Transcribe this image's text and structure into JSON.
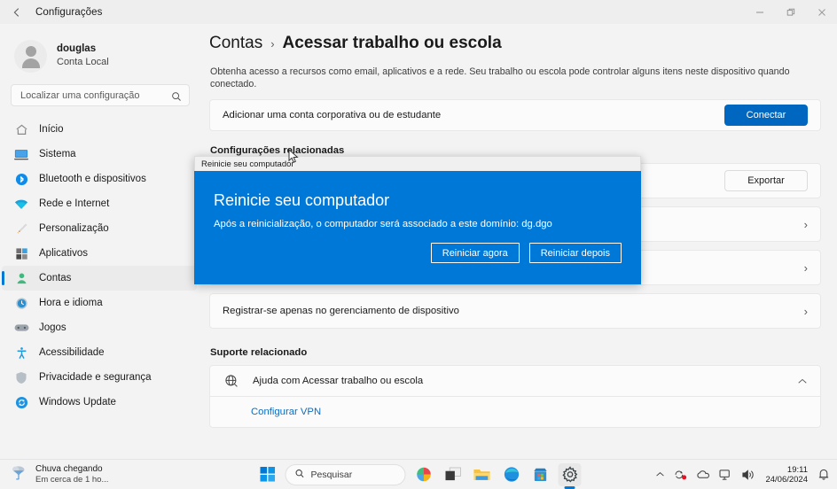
{
  "window": {
    "title": "Configurações",
    "back_icon": "back-arrow-icon",
    "minimize_label": "—",
    "maximize_label": "❐",
    "close_label": "✕"
  },
  "sidebar": {
    "profile": {
      "name": "douglas",
      "subtitle": "Conta Local"
    },
    "search": {
      "placeholder": "Localizar uma configuração",
      "icon": "search-icon"
    },
    "items": [
      {
        "label": "Início",
        "icon": "home-icon",
        "active": false
      },
      {
        "label": "Sistema",
        "icon": "system-icon",
        "active": false
      },
      {
        "label": "Bluetooth e dispositivos",
        "icon": "bluetooth-icon",
        "active": false
      },
      {
        "label": "Rede e Internet",
        "icon": "network-icon",
        "active": false
      },
      {
        "label": "Personalização",
        "icon": "personalization-icon",
        "active": false
      },
      {
        "label": "Aplicativos",
        "icon": "apps-icon",
        "active": false
      },
      {
        "label": "Contas",
        "icon": "accounts-icon",
        "active": true
      },
      {
        "label": "Hora e idioma",
        "icon": "time-icon",
        "active": false
      },
      {
        "label": "Jogos",
        "icon": "gaming-icon",
        "active": false
      },
      {
        "label": "Acessibilidade",
        "icon": "accessibility-icon",
        "active": false
      },
      {
        "label": "Privacidade e segurança",
        "icon": "privacy-icon",
        "active": false
      },
      {
        "label": "Windows Update",
        "icon": "update-icon",
        "active": false
      }
    ]
  },
  "main": {
    "breadcrumb_parent": "Contas",
    "breadcrumb_separator": "›",
    "breadcrumb_current": "Acessar trabalho ou escola",
    "description": "Obtenha acesso a recursos como email, aplicativos e a rede. Seu trabalho ou escola pode controlar alguns itens neste dispositivo quando conectado.",
    "add_account": {
      "label": "Adicionar uma conta corporativa ou de estudante",
      "button": "Conectar"
    },
    "related_settings_title": "Configurações relacionadas",
    "rows": [
      {
        "label": "",
        "action_type": "button",
        "action": "Exportar"
      },
      {
        "label": "",
        "action_type": "chevron",
        "action": "›"
      },
      {
        "label": "",
        "action_type": "chevron",
        "action": "›"
      },
      {
        "label": "Registrar-se apenas no gerenciamento de dispositivo",
        "action_type": "chevron",
        "action": "›"
      }
    ],
    "support_title": "Suporte relacionado",
    "support": {
      "label": "Ajuda com Acessar trabalho ou escola",
      "icon": "globe-help-icon",
      "expand_icon": "chevron-up-icon",
      "link": "Configurar VPN"
    }
  },
  "dialog": {
    "titlebar": "Reinicie seu computador",
    "heading": "Reinicie seu computador",
    "message": "Após a reinicialização, o computador será associado a este domínio: dg.dgo",
    "primary_button": "Reiniciar agora",
    "secondary_button": "Reiniciar depois",
    "background_color": "#0078d7"
  },
  "taskbar": {
    "weather": {
      "title": "Chuva chegando",
      "subtitle": "Em cerca de 1 ho...",
      "icon": "rain-icon"
    },
    "start": "start-icon",
    "search": {
      "placeholder": "Pesquisar",
      "icon": "search-icon"
    },
    "pinned": [
      {
        "name": "office-icon",
        "active": false
      },
      {
        "name": "task-view-icon",
        "active": false
      },
      {
        "name": "file-explorer-icon",
        "active": false
      },
      {
        "name": "edge-icon",
        "active": false
      },
      {
        "name": "microsoft-store-icon",
        "active": false
      },
      {
        "name": "settings-icon",
        "active": true
      }
    ],
    "tray": {
      "overflow": "^",
      "icons": [
        "onedrive-sync-icon",
        "cloud-icon",
        "network-icon",
        "volume-icon"
      ],
      "time": "19:11",
      "date": "24/06/2024",
      "notifications": "bell-icon"
    }
  },
  "colors": {
    "accent": "#0067c0",
    "dialog_blue": "#0078d7",
    "link": "#0f6cbd",
    "page_bg": "#f3f3f3",
    "card_bg": "#fbfbfb"
  }
}
